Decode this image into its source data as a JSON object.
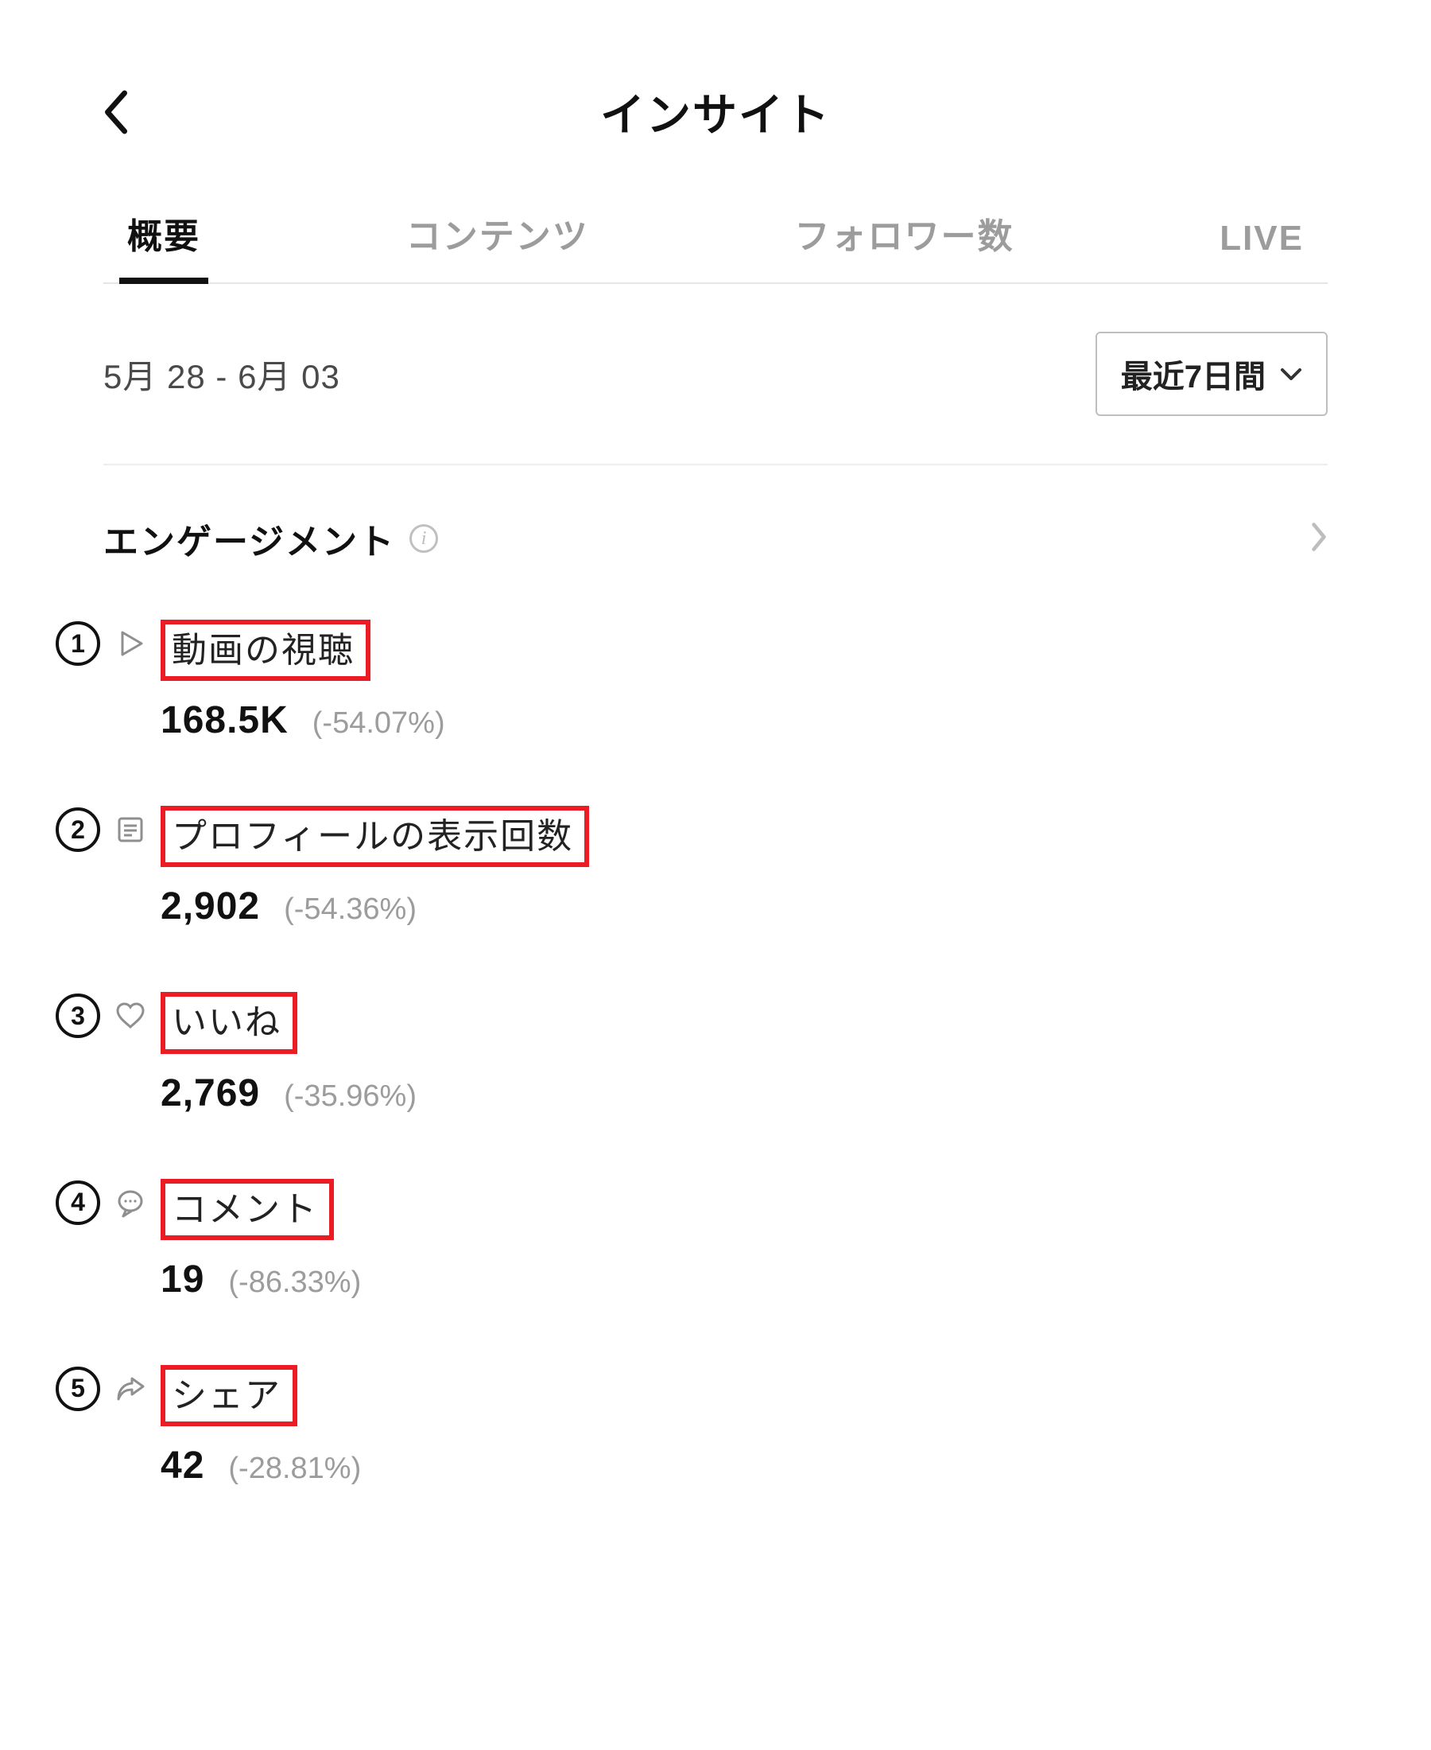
{
  "header": {
    "title": "インサイト"
  },
  "tabs": {
    "items": [
      "概要",
      "コンテンツ",
      "フォロワー数",
      "LIVE"
    ],
    "active_index": 0
  },
  "filter": {
    "date_range": "5月 28 - 6月 03",
    "range_selected": "最近7日間"
  },
  "section": {
    "title": "エンゲージメント"
  },
  "metrics": [
    {
      "badge": "1",
      "icon": "play-icon",
      "label": "動画の視聴",
      "value": "168.5K",
      "delta": "(-54.07%)"
    },
    {
      "badge": "2",
      "icon": "profile-icon",
      "label": "プロフィールの表示回数",
      "value": "2,902",
      "delta": "(-54.36%)"
    },
    {
      "badge": "3",
      "icon": "heart-icon",
      "label": "いいね",
      "value": "2,769",
      "delta": "(-35.96%)"
    },
    {
      "badge": "4",
      "icon": "comment-icon",
      "label": "コメント",
      "value": "19",
      "delta": "(-86.33%)"
    },
    {
      "badge": "5",
      "icon": "share-icon",
      "label": "シェア",
      "value": "42",
      "delta": "(-28.81%)"
    }
  ]
}
